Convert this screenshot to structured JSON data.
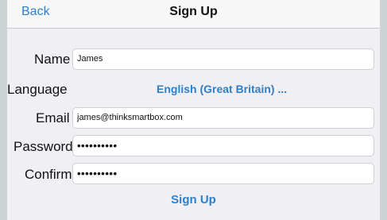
{
  "colors": {
    "accent": "#2f7fc9",
    "background": "#efeff4",
    "outer": "#cdd2d3",
    "field_border": "#cfcfd4"
  },
  "navbar": {
    "back_label": "Back",
    "title": "Sign Up"
  },
  "form": {
    "name": {
      "label": "Name",
      "value": "James"
    },
    "language": {
      "label": "Language",
      "value": "English (Great Britain) ..."
    },
    "email": {
      "label": "Email",
      "value": "james@thinksmartbox.com"
    },
    "password": {
      "label": "Password",
      "value": "••••••••••"
    },
    "confirm": {
      "label": "Confirm",
      "value": "••••••••••"
    }
  },
  "actions": {
    "signup_label": "Sign Up"
  }
}
